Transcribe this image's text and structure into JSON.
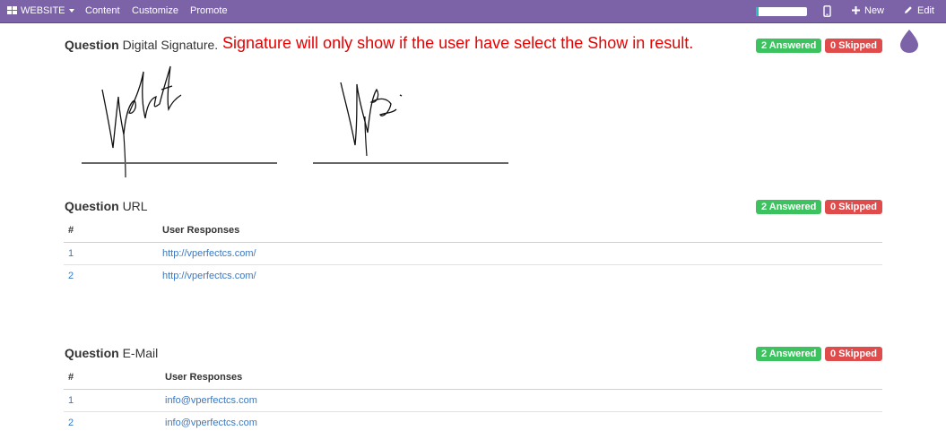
{
  "navbar": {
    "website_label": "WEBSITE",
    "content_label": "Content",
    "customize_label": "Customize",
    "promote_label": "Promote",
    "new_label": "New",
    "edit_label": "Edit",
    "accent_color": "#7c63a8",
    "progress_fraction": 0.05
  },
  "annotation": "Signature will only show if the user have select the Show in result.",
  "questions": {
    "signature": {
      "prefix": "Question",
      "title": "Digital Signature.",
      "answered": "2 Answered",
      "skipped": "0 Skipped"
    },
    "url": {
      "prefix": "Question",
      "title": "URL",
      "answered": "2 Answered",
      "skipped": "0 Skipped",
      "columns": [
        "#",
        "User Responses"
      ],
      "rows": [
        {
          "num": "1",
          "response": "http://vperfectcs.com/"
        },
        {
          "num": "2",
          "response": "http://vperfectcs.com/"
        }
      ]
    },
    "email": {
      "prefix": "Question",
      "title": "E-Mail",
      "answered": "2 Answered",
      "skipped": "0 Skipped",
      "columns": [
        "#",
        "User Responses"
      ],
      "rows": [
        {
          "num": "1",
          "response": "info@vperfectcs.com"
        },
        {
          "num": "2",
          "response": "info@vperfectcs.com"
        }
      ]
    }
  },
  "colors": {
    "answered": "#3cc35f",
    "skipped": "#e04b4b",
    "annotation": "#e80000",
    "link": "#3a78c2"
  }
}
